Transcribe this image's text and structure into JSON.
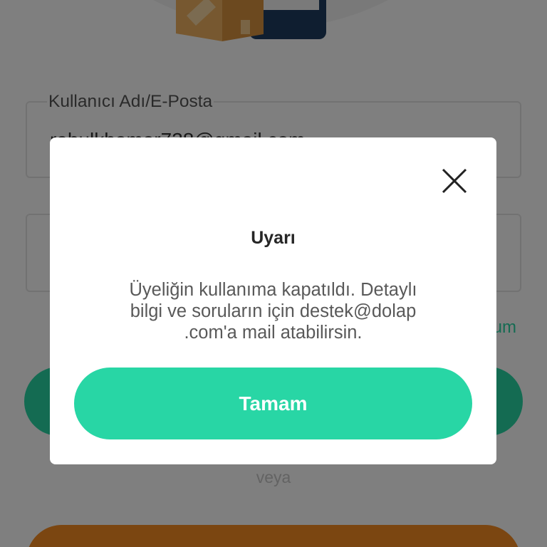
{
  "colors": {
    "accent": "#28d6a5",
    "secondary_button": "#f68c22",
    "overlay": "rgba(0,0,0,0.5)",
    "dialog_background": "#ffffff"
  },
  "illustration": {
    "icons": [
      "phone-icon",
      "package-box-icon"
    ]
  },
  "login_form": {
    "username_label": "Kullanıcı Adı/E-Posta",
    "username_value": "rahulkhamar738@gmail.com",
    "link_text": "um",
    "divider_text": "veya"
  },
  "alert_dialog": {
    "close_icon": "close-icon",
    "title": "Uyarı",
    "message_lines": [
      "Üyeliğin kullanıma kapatıldı. Detaylı",
      "bilgi ve soruların için destek@dolap",
      ".com'a mail atabilirsin."
    ],
    "confirm_label": "Tamam"
  }
}
